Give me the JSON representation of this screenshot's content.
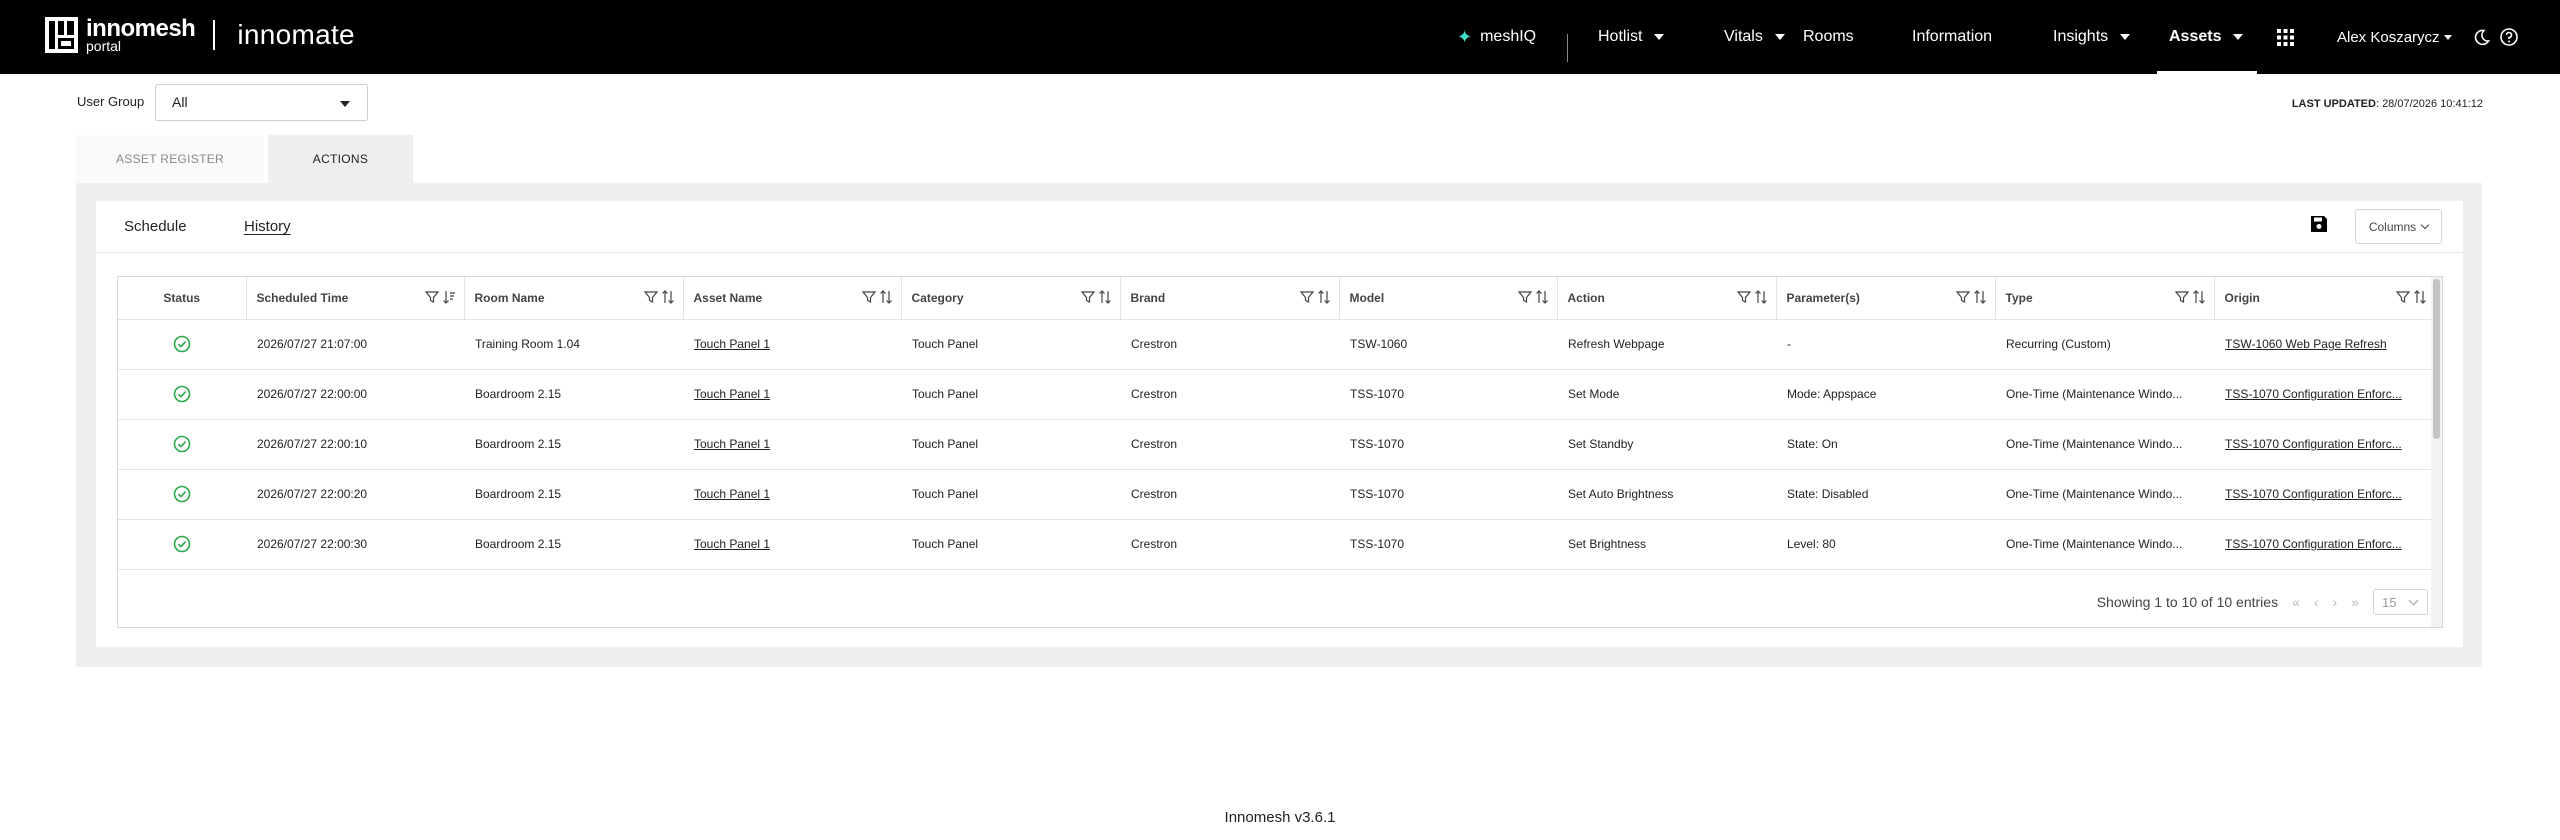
{
  "brand": {
    "logo_main": "innomesh",
    "logo_sub": "portal",
    "product": "innomate"
  },
  "nav": {
    "meshiq": "meshIQ",
    "hotlist": "Hotlist",
    "vitals": "Vitals",
    "rooms": "Rooms",
    "information": "Information",
    "insights": "Insights",
    "assets": "Assets",
    "user": "Alex Koszarycz"
  },
  "filters": {
    "user_group_label": "User Group",
    "user_group_value": "All"
  },
  "last_updated": {
    "label": "LAST UPDATED",
    "value": ": 28/07/2026 10:41:12"
  },
  "tabs": {
    "asset_register": "ASSET REGISTER",
    "actions": "ACTIONS"
  },
  "subtabs": {
    "schedule": "Schedule",
    "history": "History"
  },
  "columns_button": "Columns",
  "table": {
    "headers": {
      "status": "Status",
      "scheduled_time": "Scheduled Time",
      "room_name": "Room Name",
      "asset_name": "Asset Name",
      "category": "Category",
      "brand": "Brand",
      "model": "Model",
      "action": "Action",
      "parameters": "Parameter(s)",
      "type": "Type",
      "origin": "Origin"
    },
    "rows": [
      {
        "status": "success",
        "scheduled_time": "2026/07/27 21:07:00",
        "room_name": "Training Room 1.04",
        "asset_name": "Touch Panel 1",
        "category": "Touch Panel",
        "brand": "Crestron",
        "model": "TSW-1060",
        "action": "Refresh Webpage",
        "parameters": "-",
        "type": "Recurring (Custom)",
        "origin": "TSW-1060 Web Page Refresh"
      },
      {
        "status": "success",
        "scheduled_time": "2026/07/27 22:00:00",
        "room_name": "Boardroom 2.15",
        "asset_name": "Touch Panel 1",
        "category": "Touch Panel",
        "brand": "Crestron",
        "model": "TSS-1070",
        "action": "Set Mode",
        "parameters": "Mode: Appspace",
        "type": "One-Time (Maintenance Windo...",
        "origin": "TSS-1070 Configuration Enforc..."
      },
      {
        "status": "success",
        "scheduled_time": "2026/07/27 22:00:10",
        "room_name": "Boardroom 2.15",
        "asset_name": "Touch Panel 1",
        "category": "Touch Panel",
        "brand": "Crestron",
        "model": "TSS-1070",
        "action": "Set Standby",
        "parameters": "State: On",
        "type": "One-Time (Maintenance Windo...",
        "origin": "TSS-1070 Configuration Enforc..."
      },
      {
        "status": "success",
        "scheduled_time": "2026/07/27 22:00:20",
        "room_name": "Boardroom 2.15",
        "asset_name": "Touch Panel 1",
        "category": "Touch Panel",
        "brand": "Crestron",
        "model": "TSS-1070",
        "action": "Set Auto Brightness",
        "parameters": "State: Disabled",
        "type": "One-Time (Maintenance Windo...",
        "origin": "TSS-1070 Configuration Enforc..."
      },
      {
        "status": "success",
        "scheduled_time": "2026/07/27 22:00:30",
        "room_name": "Boardroom 2.15",
        "asset_name": "Touch Panel 1",
        "category": "Touch Panel",
        "brand": "Crestron",
        "model": "TSS-1070",
        "action": "Set Brightness",
        "parameters": "Level: 80",
        "type": "One-Time (Maintenance Windo...",
        "origin": "TSS-1070 Configuration Enforc..."
      }
    ]
  },
  "pagination": {
    "summary": "Showing 1 to 10 of 10 entries",
    "page_size": "15"
  },
  "footer": "Innomesh v3.6.1",
  "colors": {
    "success": "#2aa84a",
    "nav_bg": "#000000",
    "accent": "#3ee0c8"
  }
}
